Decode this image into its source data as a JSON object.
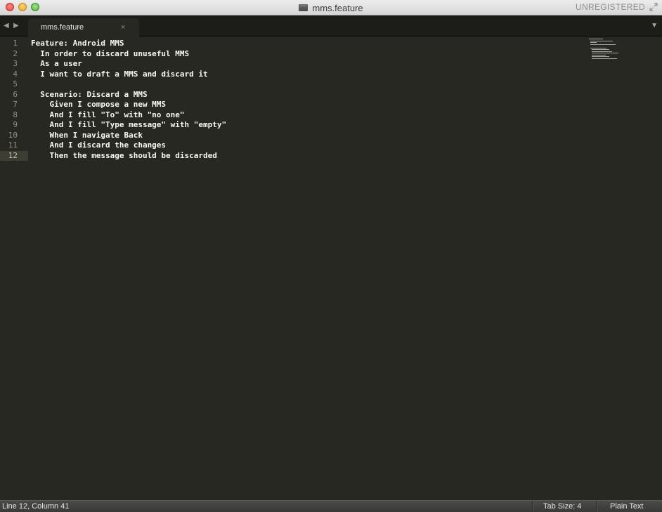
{
  "window": {
    "title": "mms.feature",
    "license_label": "UNREGISTERED"
  },
  "tabs": [
    {
      "label": "mms.feature",
      "close_glyph": "×",
      "active": true
    }
  ],
  "navigation": {
    "back_glyph": "◀",
    "forward_glyph": "▶",
    "dropdown_glyph": "▼"
  },
  "editor": {
    "current_line": 12,
    "lines": [
      {
        "number": "1",
        "text": "Feature: Android MMS"
      },
      {
        "number": "2",
        "text": "  In order to discard unuseful MMS"
      },
      {
        "number": "3",
        "text": "  As a user"
      },
      {
        "number": "4",
        "text": "  I want to draft a MMS and discard it"
      },
      {
        "number": "5",
        "text": ""
      },
      {
        "number": "6",
        "text": "  Scenario: Discard a MMS"
      },
      {
        "number": "7",
        "text": "    Given I compose a new MMS"
      },
      {
        "number": "8",
        "text": "    And I fill \"To\" with \"no one\""
      },
      {
        "number": "9",
        "text": "    And I fill \"Type message\" with \"empty\""
      },
      {
        "number": "10",
        "text": "    When I navigate Back"
      },
      {
        "number": "11",
        "text": "    And I discard the changes"
      },
      {
        "number": "12",
        "text": "    Then the message should be discarded"
      }
    ]
  },
  "status_bar": {
    "position": "Line 12, Column 41",
    "tab_size": "Tab Size: 4",
    "syntax": "Plain Text"
  },
  "colors": {
    "editor_background": "#272822",
    "foreground": "#f8f8f2",
    "gutter_text": "#8f908a",
    "current_line_highlight": "#3e3d32"
  },
  "icons": {
    "title_document": "document-icon",
    "fullscreen": "fullscreen-icon"
  }
}
